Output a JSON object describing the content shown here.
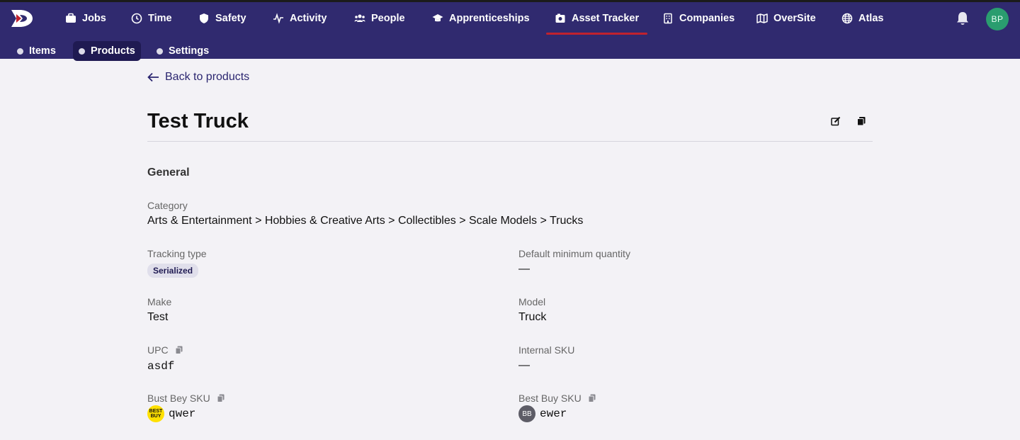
{
  "header": {
    "nav": [
      {
        "label": "Jobs",
        "icon": "briefcase-icon"
      },
      {
        "label": "Time",
        "icon": "clock-icon"
      },
      {
        "label": "Safety",
        "icon": "shield-icon"
      },
      {
        "label": "Activity",
        "icon": "pulse-icon"
      },
      {
        "label": "People",
        "icon": "people-icon"
      },
      {
        "label": "Apprenticeships",
        "icon": "graduation-cap-icon"
      },
      {
        "label": "Asset Tracker",
        "icon": "box-icon",
        "active": true
      },
      {
        "label": "Companies",
        "icon": "building-icon"
      },
      {
        "label": "OverSite",
        "icon": "map-icon"
      },
      {
        "label": "Atlas",
        "icon": "globe-icon"
      }
    ],
    "avatar_initials": "BP",
    "colors": {
      "bar": "#302a6f",
      "active_underline": "#c0222e",
      "avatar": "#2a9d6f"
    }
  },
  "subnav": [
    {
      "label": "Items"
    },
    {
      "label": "Products",
      "active": true
    },
    {
      "label": "Settings"
    }
  ],
  "page": {
    "back_label": "Back to products",
    "title": "Test Truck",
    "section": "General",
    "category_label": "Category",
    "category_value": "Arts & Entertainment > Hobbies & Creative Arts > Collectibles > Scale Models > Trucks",
    "tracking_label": "Tracking type",
    "tracking_value": "Serialized",
    "default_min_label": "Default minimum quantity",
    "default_min_value": "—",
    "make_label": "Make",
    "make_value": "Test",
    "model_label": "Model",
    "model_value": "Truck",
    "upc_label": "UPC",
    "upc_value": "asdf",
    "internal_sku_label": "Internal SKU",
    "internal_sku_value": "—",
    "bustbey_label": "Bust Bey SKU",
    "bustbey_logo": "BEST BUY",
    "bustbey_value": "qwer",
    "bestbuy_label": "Best Buy SKU",
    "bestbuy_logo": "BB",
    "bestbuy_value": "ewer"
  }
}
